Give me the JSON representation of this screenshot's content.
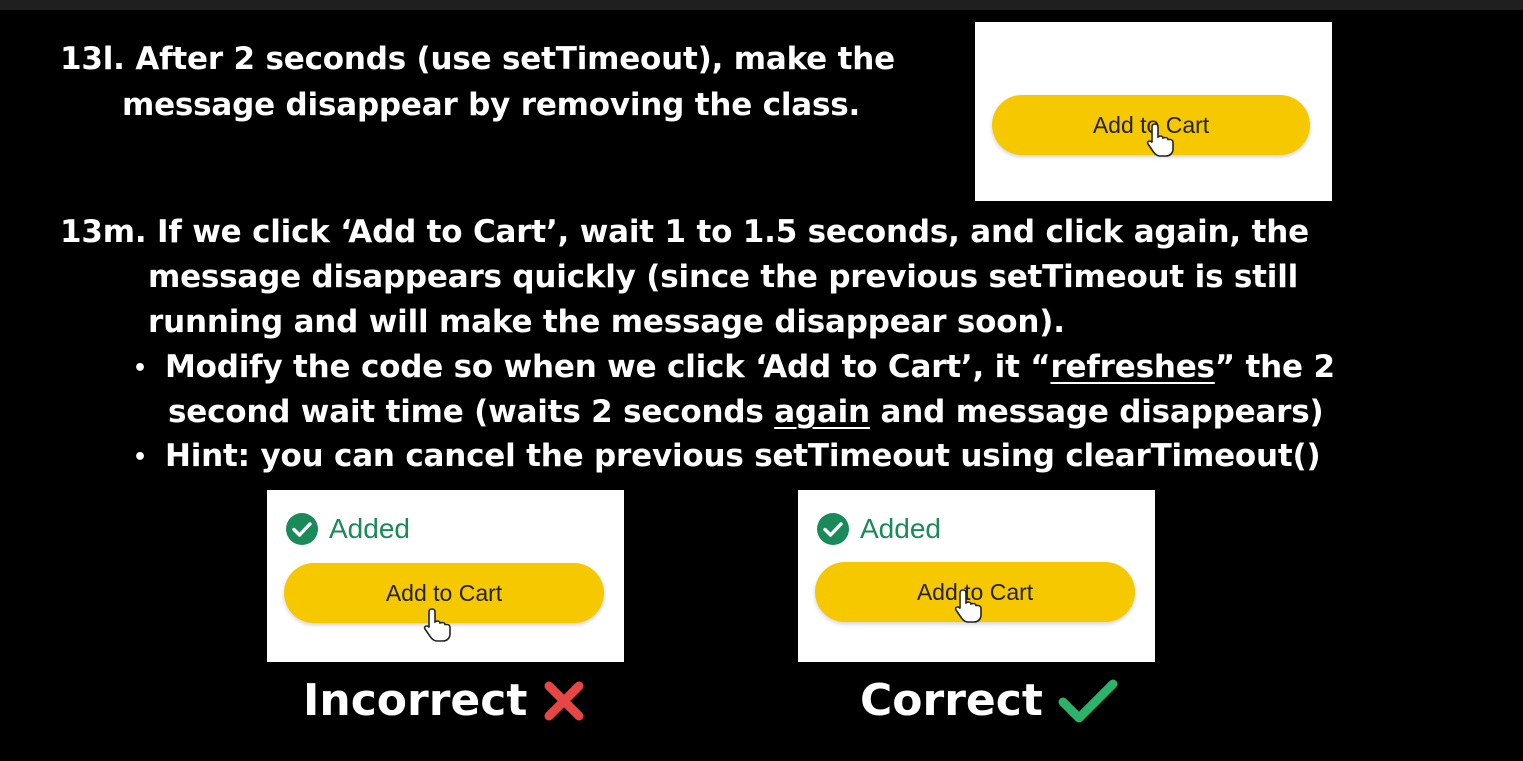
{
  "step_l": {
    "line1": "13l. After 2 seconds (use setTimeout), make the",
    "line2": "message disappear by removing the class."
  },
  "step_m": {
    "line1": "13m. If we click ‘Add to Cart’, wait 1 to 1.5 seconds, and click again, the",
    "line2": "message disappears quickly (since the previous setTimeout is still",
    "line3": "running and will make the message disappear soon).",
    "bullets": [
      {
        "pre": "Modify the code so when we click ‘Add to Cart’, it “",
        "underline": "refreshes",
        "post": "” the 2",
        "line2_pre": "second wait time (waits 2 seconds ",
        "line2_underline": "again",
        "line2_post": " and message disappears)"
      },
      {
        "text": "Hint: you can cancel the previous setTimeout using clearTimeout()"
      }
    ]
  },
  "demo_top": {
    "button_label": "Add to Cart"
  },
  "demo_incorrect": {
    "added_label": "Added",
    "button_label": "Add to Cart",
    "verdict": "Incorrect"
  },
  "demo_correct": {
    "added_label": "Added",
    "button_label": "Add to Cart",
    "verdict": "Correct"
  },
  "colors": {
    "button": "#f5c800",
    "added_green": "#1a8a5a",
    "cross_red": "#e84545",
    "check_green": "#2bb36a"
  },
  "icons": [
    "check-circle-icon",
    "hand-cursor-icon",
    "cross-icon",
    "checkmark-icon"
  ]
}
